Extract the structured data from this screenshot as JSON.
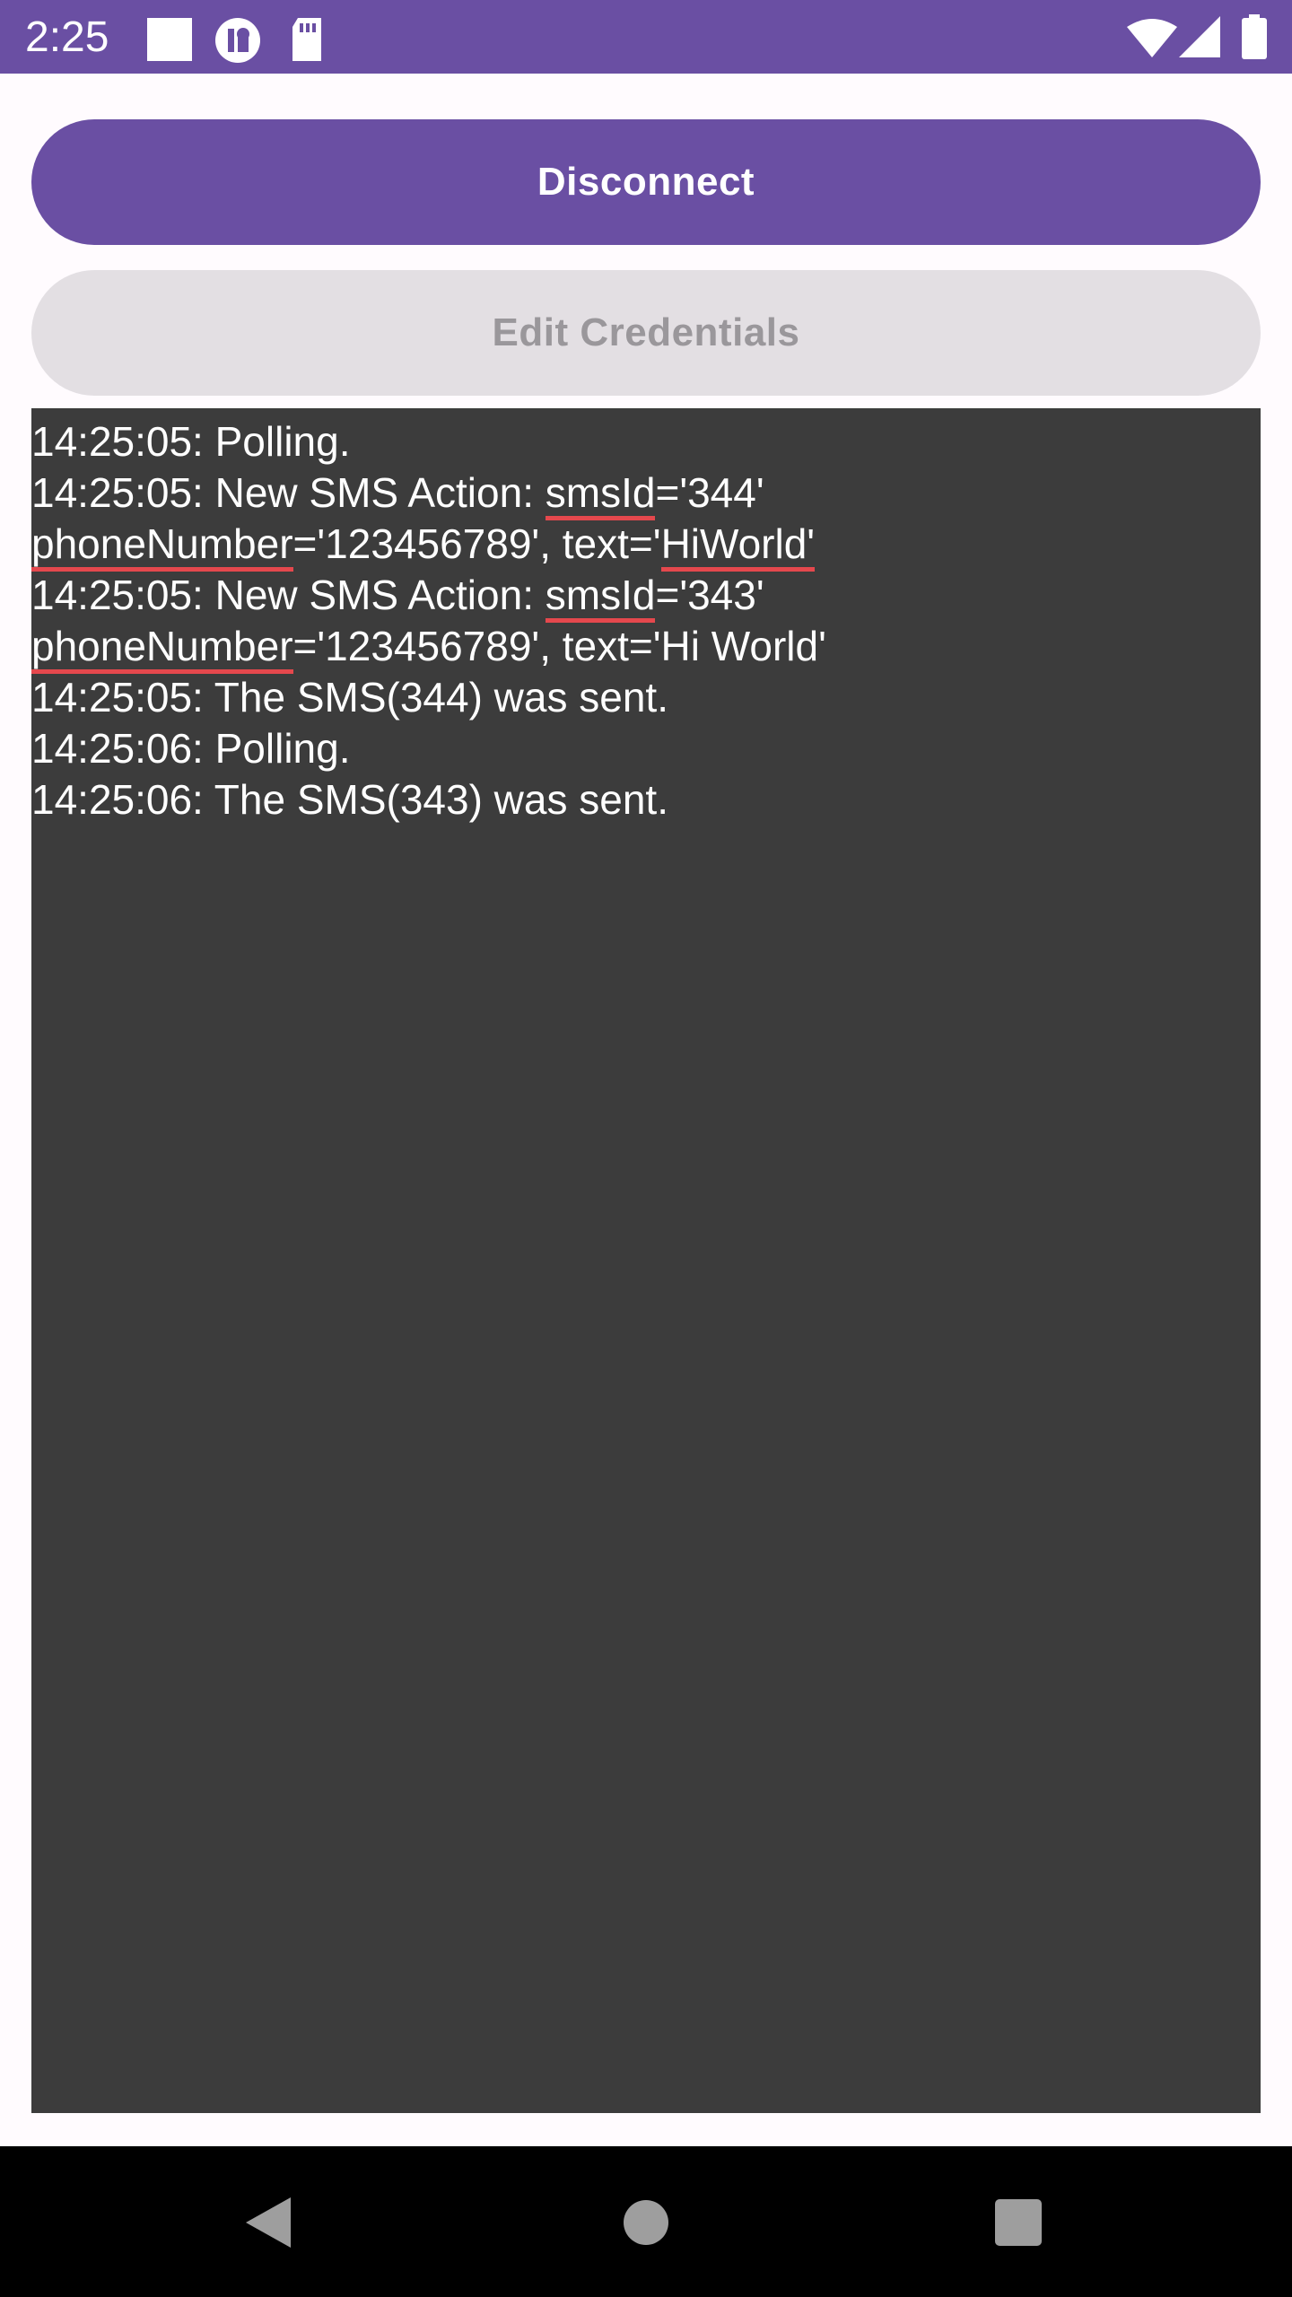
{
  "status_bar": {
    "time": "2:25",
    "background": "#6a4fa3",
    "icons": [
      "notification-square-icon",
      "app-notification-icon",
      "sd-card-icon",
      "wifi-icon",
      "cell-signal-icon",
      "battery-icon"
    ]
  },
  "buttons": {
    "disconnect_label": "Disconnect",
    "edit_credentials_label": "Edit Credentials"
  },
  "log": {
    "lines": [
      {
        "segments": [
          {
            "t": "14:25:05: Polling."
          }
        ]
      },
      {
        "segments": [
          {
            "t": "14:25:05: New SMS Action: "
          },
          {
            "t": "smsId",
            "spell": true
          },
          {
            "t": "='344'"
          }
        ]
      },
      {
        "segments": [
          {
            "t": "phoneNumber",
            "spell": true
          },
          {
            "t": "='123456789', text='"
          },
          {
            "t": "HiWorld'",
            "spell": true
          }
        ]
      },
      {
        "segments": [
          {
            "t": "14:25:05: New SMS Action: "
          },
          {
            "t": "smsId",
            "spell": true
          },
          {
            "t": "='343'"
          }
        ]
      },
      {
        "segments": [
          {
            "t": "phoneNumber",
            "spell": true
          },
          {
            "t": "='123456789', text='Hi World'"
          }
        ]
      },
      {
        "segments": [
          {
            "t": "14:25:05: The SMS(344) was sent."
          }
        ]
      },
      {
        "segments": [
          {
            "t": "14:25:06: Polling."
          }
        ]
      },
      {
        "segments": [
          {
            "t": "14:25:06: The SMS(343) was sent."
          }
        ]
      }
    ]
  },
  "colors": {
    "accent": "#6a4fa3",
    "log_background": "#3c3c3c",
    "spellcheck_underline": "#e5484d"
  },
  "navigation_bar": {
    "icons": [
      "back-icon",
      "home-icon",
      "recents-icon"
    ]
  }
}
